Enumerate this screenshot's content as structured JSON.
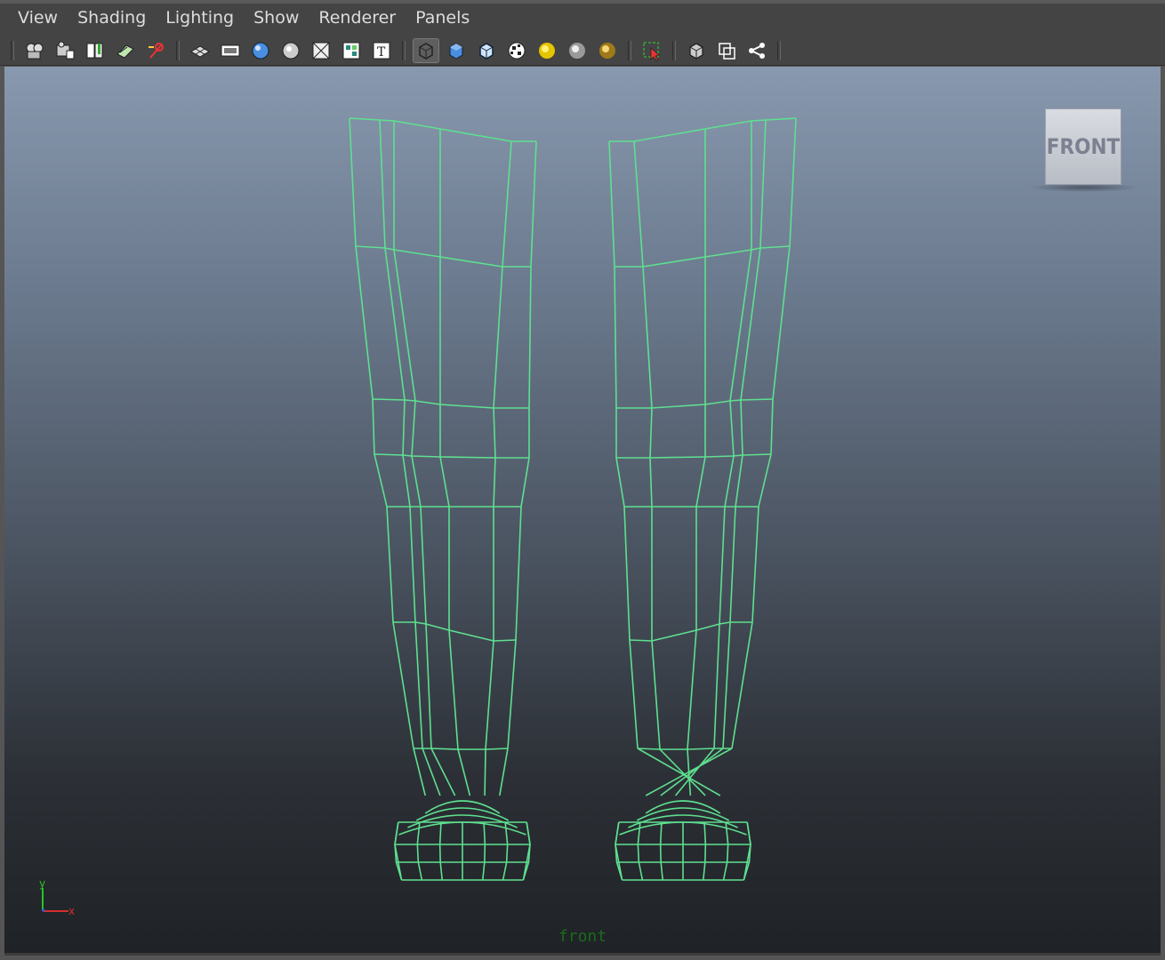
{
  "menu": [
    "View",
    "Shading",
    "Lighting",
    "Show",
    "Renderer",
    "Panels"
  ],
  "toolbar": {
    "groups": [
      [
        "select-camera-icon",
        "camera-attributes-icon",
        "bookmarks-icon",
        "image-plane-icon",
        "2d-pan-zoom-icon"
      ],
      [
        "grid-icon",
        "film-gate-icon",
        "resolution-gate-icon",
        "gate-mask-icon",
        "field-chart-icon",
        "safe-action-icon",
        "safe-title-icon"
      ],
      [
        "wireframe-icon",
        "smooth-shade-icon",
        "wireframe-on-shaded-icon",
        "textured-icon",
        "use-all-lights-icon",
        "shadows-icon",
        "ambient-occlusion-icon"
      ],
      [
        "isolate-select-icon"
      ],
      [
        "xray-icon",
        "xray-joints-icon",
        "xray-active-icon"
      ]
    ],
    "active": "wireframe-icon"
  },
  "viewcube": {
    "label": "FRONT"
  },
  "axis": {
    "y": "y",
    "x": "x"
  },
  "camera_label": "front",
  "colors": {
    "wireframe": "#5ee08f",
    "menu_bg": "#444444",
    "accent": "#e5c400"
  }
}
